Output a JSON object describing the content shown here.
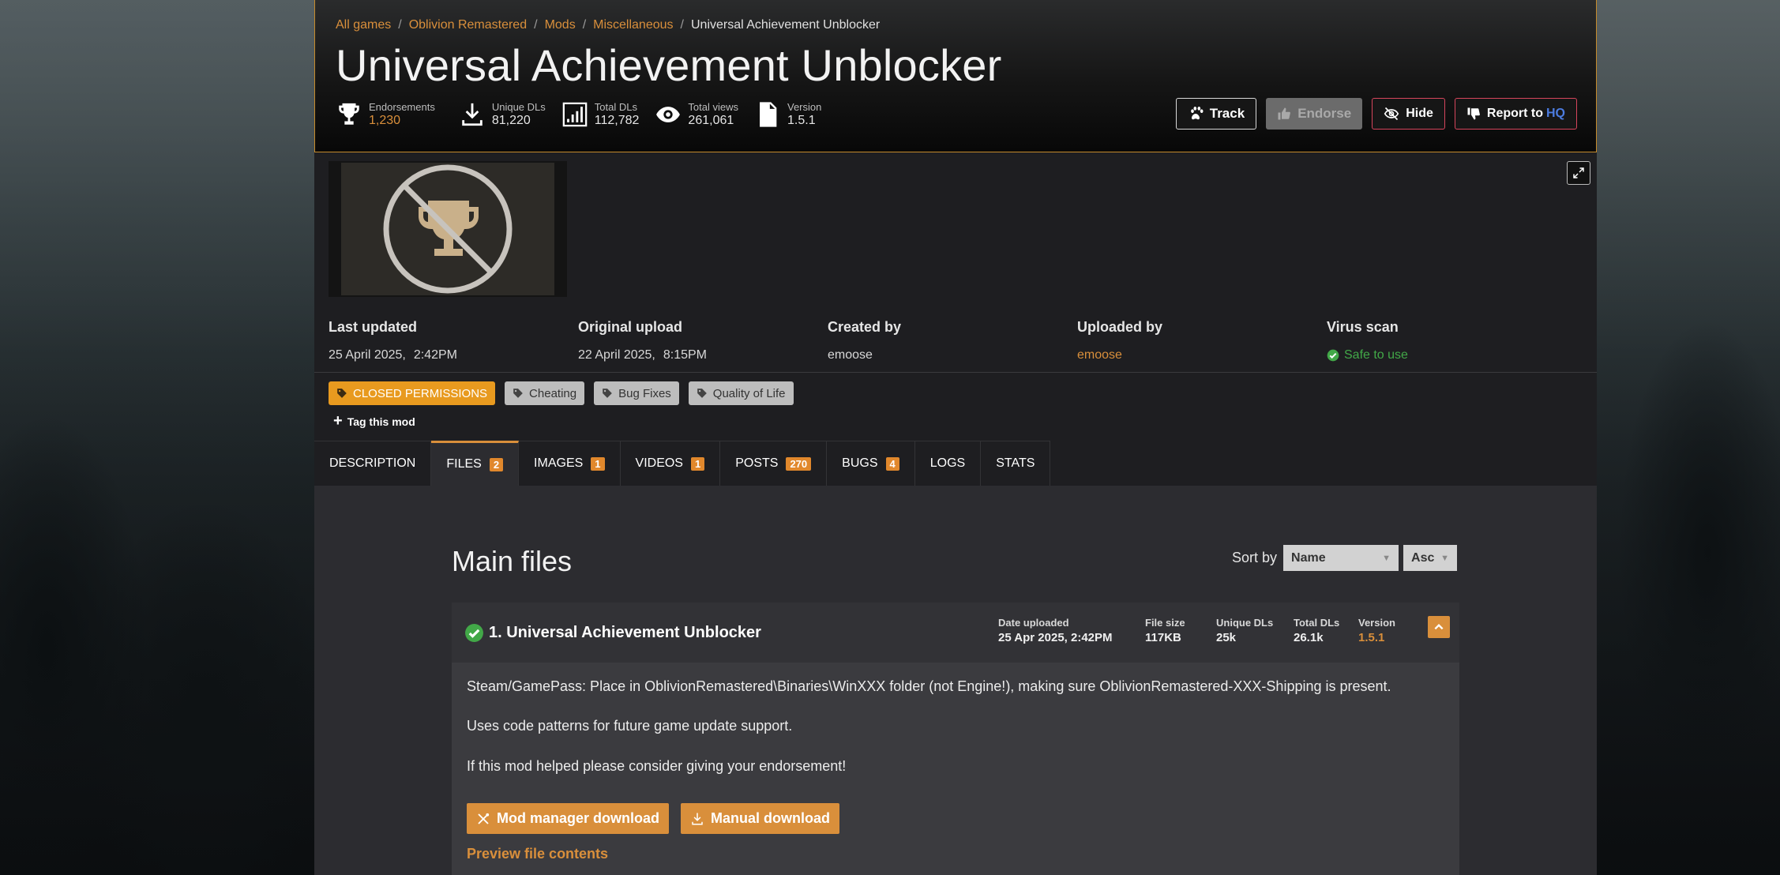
{
  "breadcrumb": [
    "All games",
    "Oblivion Remastered",
    "Mods",
    "Miscellaneous",
    "Universal Achievement Unblocker"
  ],
  "title": "Universal Achievement Unblocker",
  "stats": [
    {
      "label": "Endorsements",
      "value": "1,230",
      "icon": "trophy-icon"
    },
    {
      "label": "Unique DLs",
      "value": "81,220",
      "icon": "download-icon"
    },
    {
      "label": "Total DLs",
      "value": "112,782",
      "icon": "bar-chart-icon"
    },
    {
      "label": "Total views",
      "value": "261,061",
      "icon": "eye-icon"
    },
    {
      "label": "Version",
      "value": "1.5.1",
      "icon": "document-icon"
    }
  ],
  "actions": {
    "track": "Track",
    "endorse": "Endorse",
    "hide": "Hide",
    "report": "Report to",
    "report_hq": "HQ"
  },
  "meta": {
    "last_updated": {
      "label": "Last updated",
      "date": "25 April 2025,",
      "time": "2:42PM"
    },
    "original_upload": {
      "label": "Original upload",
      "date": "22 April 2025,",
      "time": "8:15PM"
    },
    "created_by": {
      "label": "Created by",
      "value": "emoose"
    },
    "uploaded_by": {
      "label": "Uploaded by",
      "value": "emoose"
    },
    "virus_scan": {
      "label": "Virus scan",
      "value": "Safe to use"
    }
  },
  "tags": [
    "CLOSED PERMISSIONS",
    "Cheating",
    "Bug Fixes",
    "Quality of Life"
  ],
  "tag_this_mod": "Tag this mod",
  "tabs": [
    {
      "label": "DESCRIPTION",
      "count": ""
    },
    {
      "label": "FILES",
      "count": "2"
    },
    {
      "label": "IMAGES",
      "count": "1"
    },
    {
      "label": "VIDEOS",
      "count": "1"
    },
    {
      "label": "POSTS",
      "count": "270"
    },
    {
      "label": "BUGS",
      "count": "4"
    },
    {
      "label": "LOGS",
      "count": ""
    },
    {
      "label": "STATS",
      "count": ""
    }
  ],
  "main_files": {
    "heading": "Main files",
    "sort_label": "Sort by",
    "sort_field": "Name",
    "sort_order": "Asc",
    "file": {
      "name": "1. Universal Achievement Unblocker",
      "date_label": "Date uploaded",
      "date": "25 Apr 2025, 2:42PM",
      "size_label": "File size",
      "size": "117KB",
      "unique_label": "Unique DLs",
      "unique": "25k",
      "total_label": "Total DLs",
      "total": "26.1k",
      "version_label": "Version",
      "version": "1.5.1",
      "desc": [
        "Steam/GamePass: Place in OblivionRemastered\\Binaries\\WinXXX folder (not Engine!), making sure OblivionRemastered-XXX-Shipping is present.",
        "Uses code patterns for future game update support.",
        "If this mod helped please consider giving your endorsement!"
      ],
      "mod_manager_download": "Mod manager download",
      "manual_download": "Manual download",
      "preview": "Preview file contents"
    }
  }
}
